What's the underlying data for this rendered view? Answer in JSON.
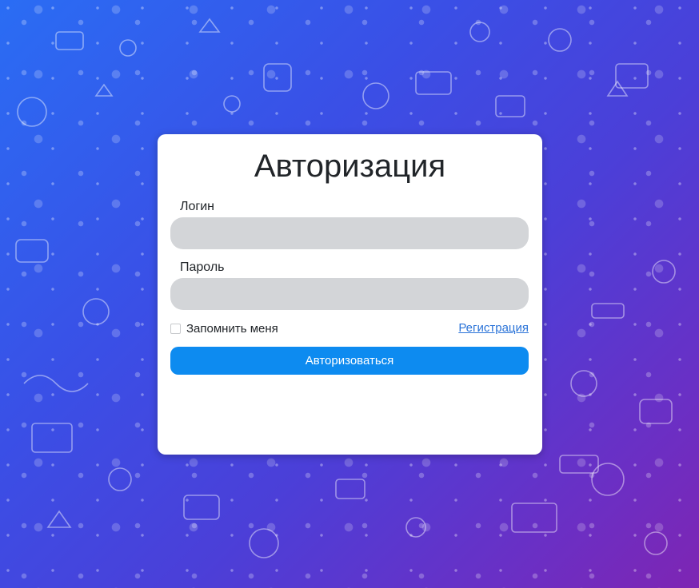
{
  "colors": {
    "background_start": "#2a6df4",
    "background_end": "#7e25b3",
    "card": "#ffffff",
    "input_fill": "#d3d5d8",
    "button": "#0d8bf0",
    "link": "#2a73d8"
  },
  "form": {
    "title": "Авторизация",
    "login_label": "Логин",
    "login_value": "",
    "password_label": "Пароль",
    "password_value": "",
    "remember_label": "Запомнить меня",
    "remember_checked": false,
    "register_link": "Регистрация",
    "submit_label": "Авторизоваться"
  },
  "background": {
    "pattern": "doodle-pattern"
  }
}
